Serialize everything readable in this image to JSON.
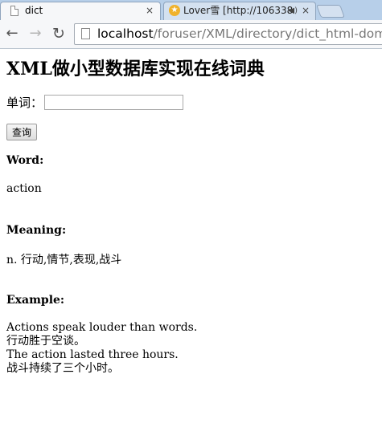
{
  "browser": {
    "active_tab": {
      "title": "dict",
      "close": "×"
    },
    "inactive_tab": {
      "title": "Lover雪 [http://106338",
      "close": "×"
    },
    "nav": {
      "back": "←",
      "forward": "→",
      "reload": "↻"
    },
    "url": {
      "host": "localhost",
      "path": "/foruser/XML/directory/dict_html-dom.php"
    }
  },
  "page": {
    "title": "XML做小型数据库实现在线词典",
    "word_label": "单词：",
    "word_input_value": "",
    "query_button": "查询",
    "word_heading": "Word:",
    "word_value": "action",
    "meaning_heading": "Meaning:",
    "meaning_value": "n. 行动,情节,表现,战斗",
    "example_heading": "Example:",
    "examples": [
      "Actions speak louder than words.",
      "行动胜于空谈。",
      "The action lasted three hours.",
      "战斗持续了三个小时。"
    ]
  }
}
